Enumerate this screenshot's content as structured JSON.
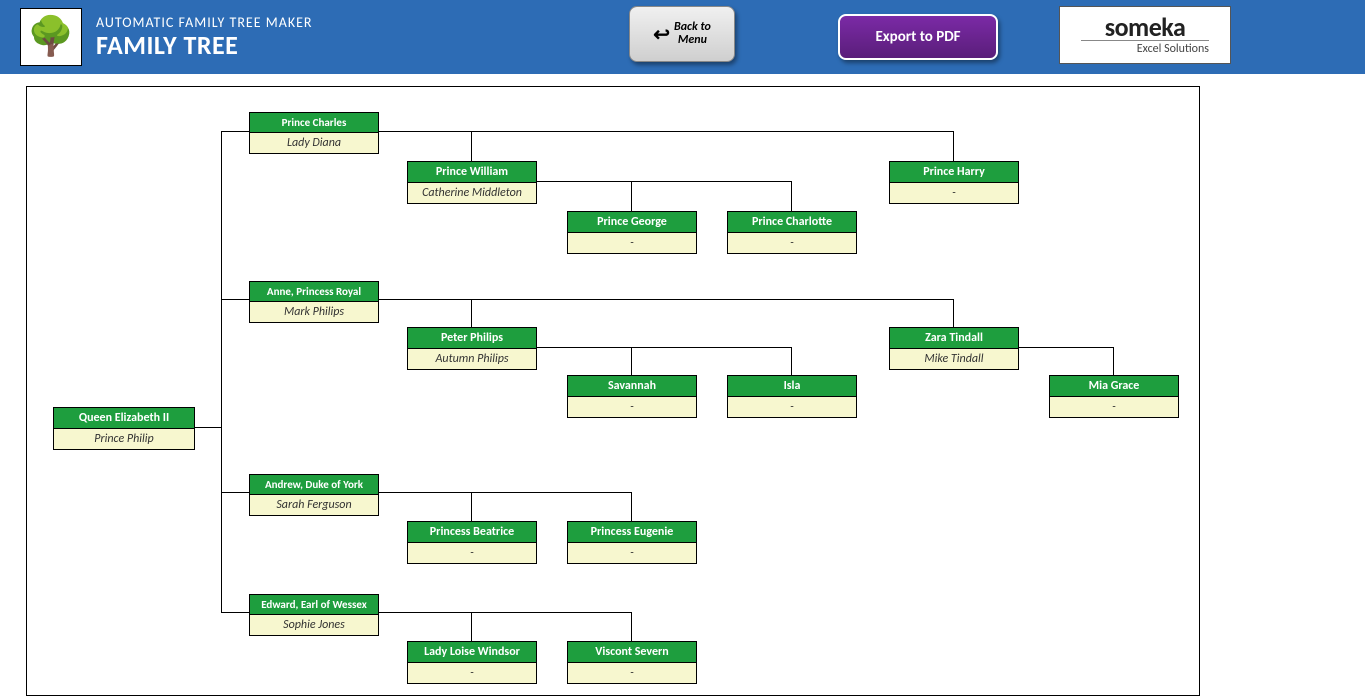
{
  "header": {
    "subtitle": "AUTOMATIC FAMILY TREE MAKER",
    "title": "FAMILY TREE",
    "back_label": "Back to\nMenu",
    "export_label": "Export to PDF",
    "brand_top": "someka",
    "brand_bottom": "Excel Solutions"
  },
  "tree": {
    "root": {
      "name": "Queen Elizabeth II",
      "spouse": "Prince Philip"
    },
    "c1": {
      "name": "Prince Charles",
      "spouse": "Lady Diana"
    },
    "c1a": {
      "name": "Prince William",
      "spouse": "Catherine Middleton"
    },
    "c1a1": {
      "name": "Prince George",
      "spouse": "-"
    },
    "c1a2": {
      "name": "Prince Charlotte",
      "spouse": "-"
    },
    "c1b": {
      "name": "Prince Harry",
      "spouse": "-"
    },
    "c2": {
      "name": "Anne, Princess Royal",
      "spouse": "Mark Philips"
    },
    "c2a": {
      "name": "Peter Philips",
      "spouse": "Autumn Philips"
    },
    "c2a1": {
      "name": "Savannah",
      "spouse": "-"
    },
    "c2a2": {
      "name": "Isla",
      "spouse": "-"
    },
    "c2b": {
      "name": "Zara Tindall",
      "spouse": "Mike Tindall"
    },
    "c2b1": {
      "name": "Mia Grace",
      "spouse": "-"
    },
    "c3": {
      "name": "Andrew, Duke of York",
      "spouse": "Sarah Ferguson"
    },
    "c3a": {
      "name": "Princess Beatrice",
      "spouse": "-"
    },
    "c3b": {
      "name": "Princess Eugenie",
      "spouse": "-"
    },
    "c4": {
      "name": "Edward, Earl of Wessex",
      "spouse": "Sophie Jones"
    },
    "c4a": {
      "name": "Lady Loise Windsor",
      "spouse": "-"
    },
    "c4b": {
      "name": "Viscont Severn",
      "spouse": "-"
    }
  }
}
